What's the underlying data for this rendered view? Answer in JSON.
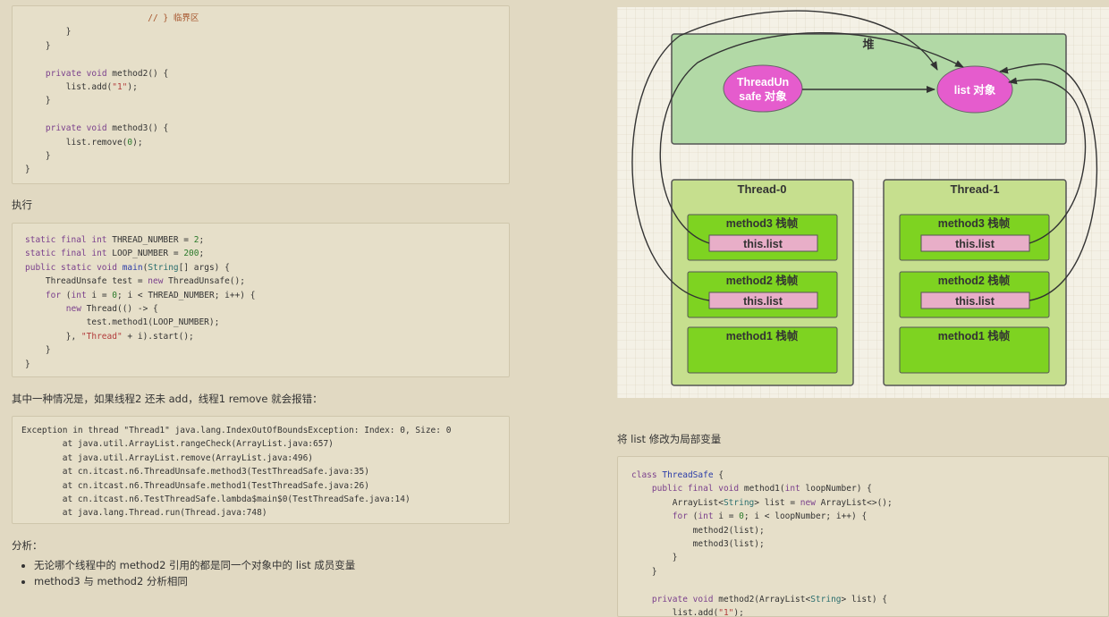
{
  "left": {
    "code_top_lines": [
      "            // } 临界区",
      "        }",
      "    }",
      "",
      "    private void method2() {",
      "        list.add(\"1\");",
      "    }",
      "",
      "    private void method3() {",
      "        list.remove(0);",
      "    }",
      "}"
    ],
    "heading_exec": "执行",
    "code_exec_lines": [
      "static final int THREAD_NUMBER = 2;",
      "static final int LOOP_NUMBER = 200;",
      "public static void main(String[] args) {",
      "    ThreadUnsafe test = new ThreadUnsafe();",
      "    for (int i = 0; i < THREAD_NUMBER; i++) {",
      "        new Thread(() -> {",
      "            test.method1(LOOP_NUMBER);",
      "        }, \"Thread\" + i).start();",
      "    }",
      "}"
    ],
    "note_error": "其中一种情况是，如果线程2 还未 add，线程1 remove 就会报错：",
    "code_exception_lines": [
      "Exception in thread \"Thread1\" java.lang.IndexOutOfBoundsException: Index: 0, Size: 0",
      "        at java.util.ArrayList.rangeCheck(ArrayList.java:657)",
      "        at java.util.ArrayList.remove(ArrayList.java:496)",
      "        at cn.itcast.n6.ThreadUnsafe.method3(TestThreadSafe.java:35)",
      "        at cn.itcast.n6.ThreadUnsafe.method1(TestThreadSafe.java:26)",
      "        at cn.itcast.n6.TestThreadSafe.lambda$main$0(TestThreadSafe.java:14)",
      "        at java.lang.Thread.run(Thread.java:748)"
    ],
    "heading_analysis": "分析：",
    "bullets": [
      "无论哪个线程中的 method2 引用的都是同一个对象中的 list 成员变量",
      "method3 与 method2 分析相同"
    ]
  },
  "diagram": {
    "heap_label": "堆",
    "threadunsafe_label_1": "ThreadUn",
    "threadunsafe_label_2": "safe 对象",
    "list_label": "list 对象",
    "thread0_label": "Thread-0",
    "thread1_label": "Thread-1",
    "method3_frame": "method3 栈帧",
    "method2_frame": "method2 栈帧",
    "method1_frame": "method1 栈帧",
    "this_list": "this.list",
    "colors": {
      "heap_fill": "#b2d9a6",
      "thread_fill": "#c6df8e",
      "frame_fill": "#7ed321",
      "ref_fill": "#e8aec8",
      "object_fill": "#e55ccd"
    }
  },
  "right": {
    "note_local": "将 list 修改为局部变量",
    "code_lines": [
      "class ThreadSafe {",
      "    public final void method1(int loopNumber) {",
      "        ArrayList<String> list = new ArrayList<>();",
      "        for (int i = 0; i < loopNumber; i++) {",
      "            method2(list);",
      "            method3(list);",
      "        }",
      "    }",
      "",
      "    private void method2(ArrayList<String> list) {",
      "        list.add(\"1\");"
    ]
  }
}
